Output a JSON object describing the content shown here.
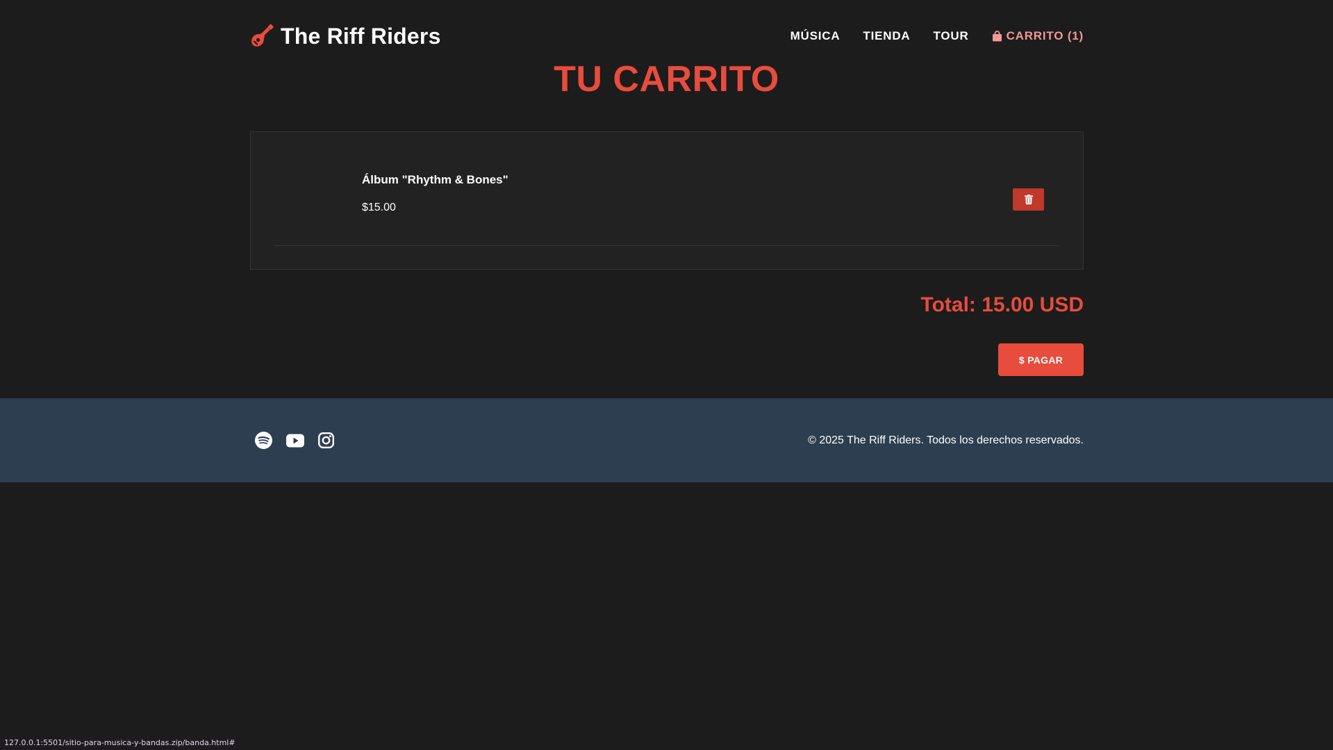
{
  "brand": {
    "name": "The Riff Riders",
    "icon": "guitar-icon",
    "icon_color": "#e74c3c"
  },
  "nav": {
    "items": [
      {
        "label": "MÚSICA"
      },
      {
        "label": "TIENDA"
      },
      {
        "label": "TOUR"
      }
    ],
    "cart_label": "CARRITO (1)",
    "cart_icon": "shopping-bag-icon",
    "cart_color": "#f19a96"
  },
  "page": {
    "title": "TU CARRITO"
  },
  "cart": {
    "items": [
      {
        "name": "Álbum \"Rhythm & Bones\"",
        "price": "$15.00",
        "remove_icon": "trash-icon"
      }
    ],
    "total": "Total: 15.00 USD",
    "pay_label": "$ PAGAR"
  },
  "footer": {
    "socials": [
      "spotify-icon",
      "youtube-icon",
      "instagram-icon"
    ],
    "copyright": "© 2025 The Riff Riders. Todos los derechos reservados."
  },
  "status_bar": {
    "url": "127.0.0.1:5501/sitio-para-musica-y-bandas.zip/banda.html#"
  },
  "colors": {
    "background": "#1c1c1c",
    "accent": "#e74c3c",
    "delete": "#c0392b",
    "footer": "#2c3e50",
    "panel": "#222222"
  }
}
